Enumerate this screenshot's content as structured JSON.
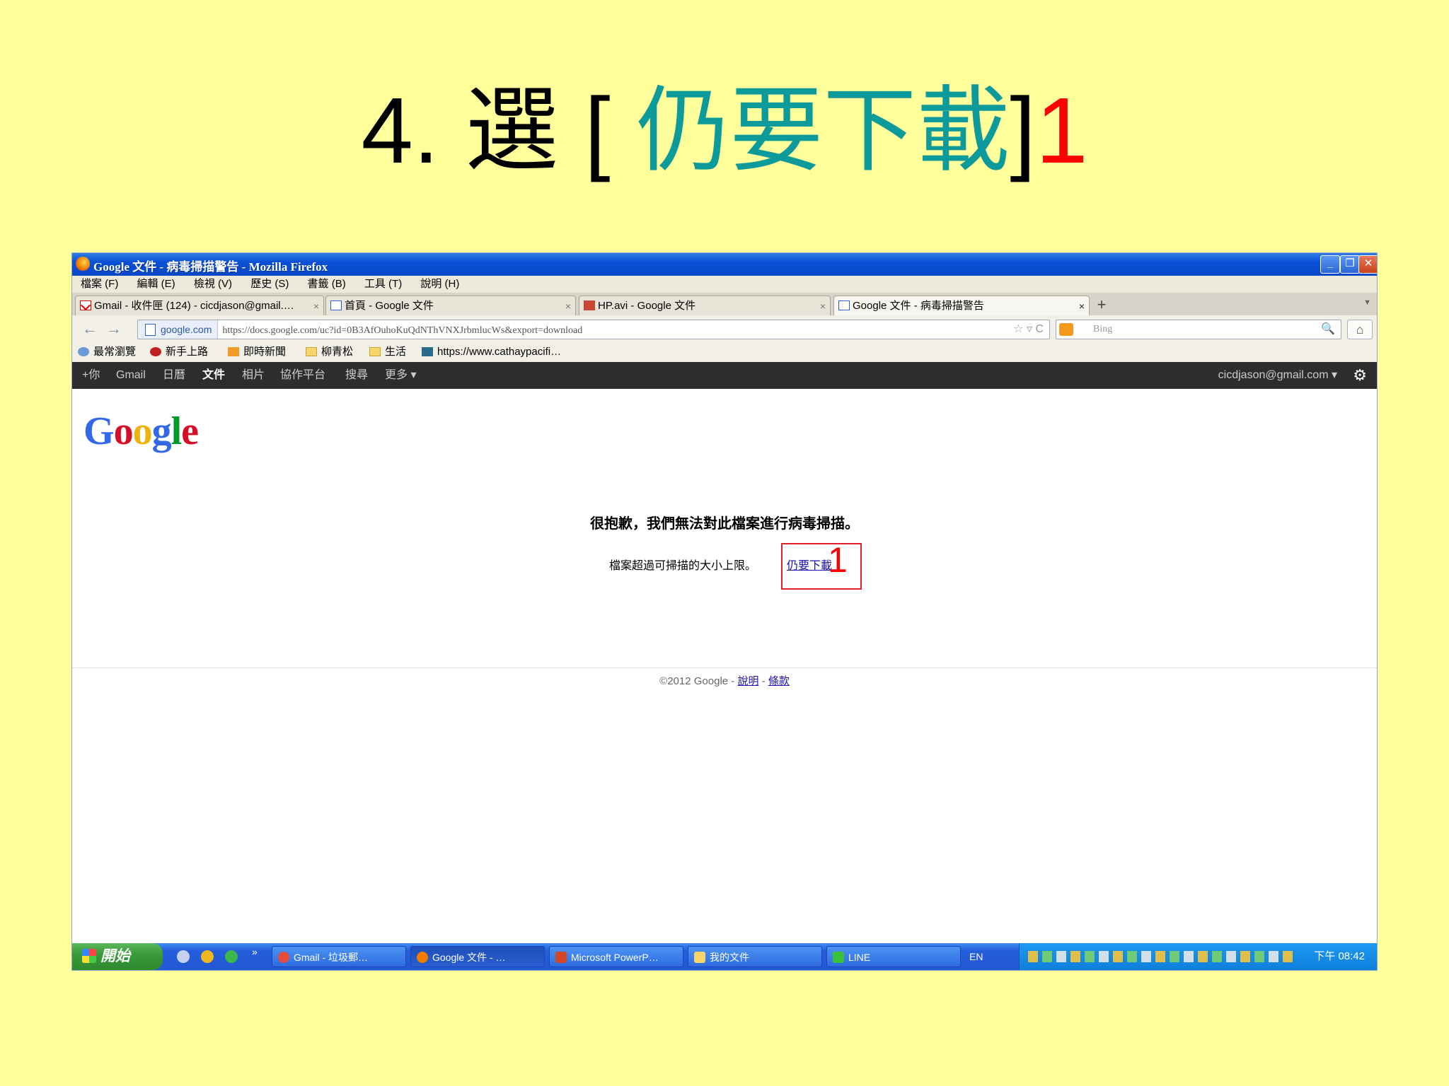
{
  "slide": {
    "title_prefix": "4. 選 [ ",
    "title_highlight": "仍要下載",
    "title_bracket": "]",
    "title_step": "1"
  },
  "window": {
    "title": "Google 文件 - 病毒掃描警告 - Mozilla Firefox",
    "minimize": "_",
    "restore": "❐",
    "close": "✕"
  },
  "menubar": [
    "檔案 (F)",
    "編輯 (E)",
    "檢視 (V)",
    "歷史 (S)",
    "書籤 (B)",
    "工具 (T)",
    "說明 (H)"
  ],
  "tabs": [
    {
      "label": "Gmail - 收件匣 (124) - cicdjason@gmail.…",
      "icon": "gmail-icon"
    },
    {
      "label": "首頁 - Google 文件",
      "icon": "doc-icon"
    },
    {
      "label": "HP.avi - Google 文件",
      "icon": "video-icon"
    },
    {
      "label": "Google 文件 - 病毒掃描警告",
      "icon": "doc-icon"
    }
  ],
  "nav": {
    "back": "←",
    "forward": "→",
    "site": "google.com",
    "url": "https://docs.google.com/uc?id=0B3AfOuhoKuQdNThVNXJrbmlucWs&export=download",
    "url_icons": "☆ ▿ C",
    "search_placeholder": "Bing",
    "search_icon": "🔍",
    "home": "⌂"
  },
  "bookmarks": [
    "最常瀏覽",
    "新手上路",
    "即時新聞",
    "柳青松",
    "生活",
    "https://www.cathaypacifi…"
  ],
  "gbar": {
    "items": [
      "+你",
      "Gmail",
      "日曆",
      "文件",
      "相片",
      "協作平台",
      "搜尋",
      "更多 ▾"
    ],
    "user": "cicdjason@gmail.com ▾",
    "gear": "⚙"
  },
  "google_logo": [
    "G",
    "o",
    "o",
    "g",
    "l",
    "e"
  ],
  "logo_colors": [
    "#3369e8",
    "#d50f25",
    "#eeb211",
    "#3369e8",
    "#009925",
    "#d50f25"
  ],
  "message": {
    "heading": "很抱歉，我們無法對此檔案進行病毒掃描。",
    "body": "檔案超過可掃描的大小上限。",
    "link": "仍要下載",
    "annotation": "1"
  },
  "footer": {
    "copyright": "©2012 Google - ",
    "help": "說明",
    "sep": " - ",
    "terms": "條款"
  },
  "taskbar": {
    "start": "開始",
    "chevron": "»",
    "tasks": [
      "Gmail - 垃圾郵…",
      "Google 文件 - …",
      "Microsoft PowerP…",
      "我的文件",
      "LINE"
    ],
    "lang": "EN",
    "clock": "下午 08:42"
  },
  "colors": {
    "slide_bg": "#ffff9c",
    "title_teal": "#0c9a9a",
    "annotation_red": "#ff0000",
    "xp_blue": "#0a4fd6",
    "link_blue": "#1a0dab"
  }
}
